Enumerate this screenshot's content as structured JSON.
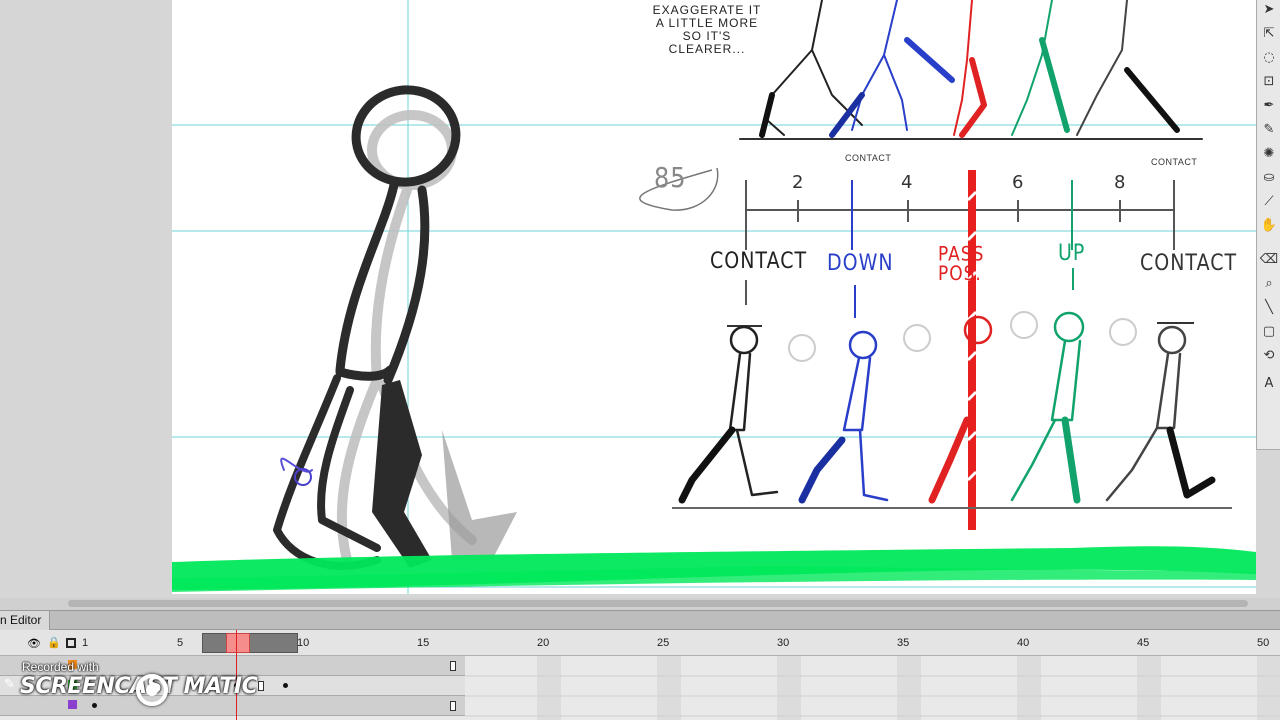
{
  "stage": {
    "annotation_note": "EXAGGERATE IT A LITTLE MORE SO IT'S CLEARER...",
    "page_number": "85",
    "contact_small_left": "CONTACT",
    "contact_small_right": "CONTACT",
    "tick_numbers": [
      "2",
      "4",
      "6",
      "8"
    ],
    "pose_labels": [
      "CONTACT",
      "DOWN",
      "PASS POS.",
      "UP",
      "CONTACT"
    ],
    "pose_colors": [
      "#222222",
      "#2a3fc9",
      "#e02222",
      "#11a36b",
      "#444444"
    ],
    "ground_color": "#00e85a"
  },
  "toolbar": {
    "tools": [
      "selection-tool",
      "subselection-tool",
      "lasso-tool",
      "transform-tool",
      "pen-tool",
      "pencil-tool",
      "brush-tool",
      "paint-bucket-tool",
      "eyedropper-tool",
      "eraser-tool",
      "hand-tool",
      "zoom-tool",
      "line-tool",
      "rectangle-tool",
      "text-tool"
    ]
  },
  "timeline": {
    "tab_label": "n Editor",
    "ruler_numbers": [
      "1",
      "5",
      "10",
      "15",
      "20",
      "25",
      "30",
      "35",
      "40",
      "45",
      "50"
    ],
    "current_frame_marker": "playhead",
    "layer_count": 3
  },
  "watermark": {
    "recorded_with": "Recorded with",
    "brand": "SCREENCAST  MATIC"
  }
}
